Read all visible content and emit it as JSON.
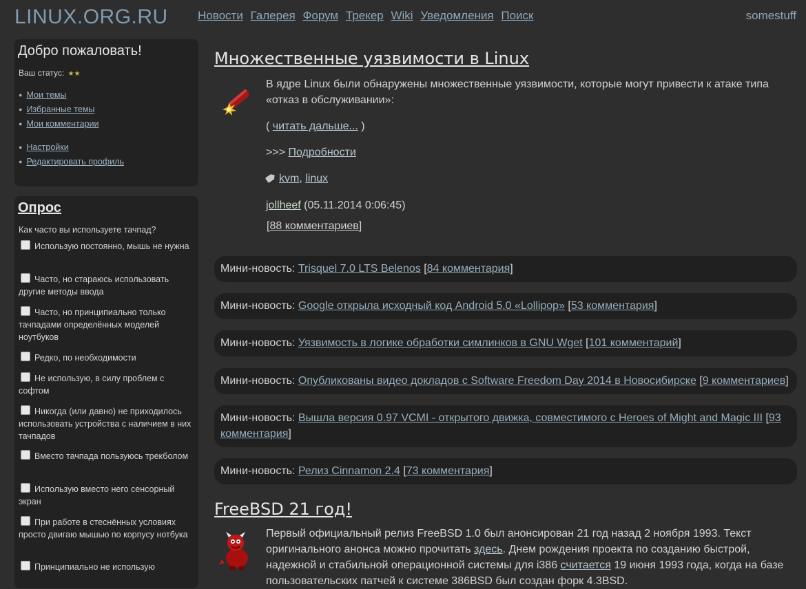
{
  "header": {
    "logo": "LINUX.ORG.RU",
    "nav": [
      "Новости",
      "Галерея",
      "Форум",
      "Трекер",
      "Wiki",
      "Уведомления",
      "Поиск"
    ],
    "user": "somestuff"
  },
  "welcome": {
    "title": "Добро пожаловать!",
    "status_label": "Ваш статус:",
    "stars": "★★",
    "links_group1": [
      "Мои темы",
      "Избранные темы",
      "Мои комментарии"
    ],
    "links_group2": [
      "Настройки",
      "Редактировать профиль"
    ]
  },
  "poll": {
    "title": "Опрос",
    "question": "Как часто вы используете тачпад?",
    "options": [
      "Использую постоянно, мышь не нужна",
      "Часто, но стараюсь использовать другие методы ввода",
      "Часто, но принципиально только тачпадами определённых моделей ноутбуков",
      "Редко, по необходимости",
      "Не использую, в силу проблем с софтом",
      "Никогда (или давно) не приходилось использовать устройства с наличием в них тачпадов",
      "Вместо тачпада пользуюсь трекболом",
      "Использую вместо него сенсорный экран",
      "При работе в стеснённых условиях просто двигаю мышью по корпусу нотбука",
      "Принципиально не использую"
    ]
  },
  "article1": {
    "title": "Множественные уязвимости в Linux",
    "text": "В ядре Linux были обнаружены множественные уязвимости, которые могут привести к атаке типа «отказ в обслуживании»:",
    "read_more_open": "( ",
    "read_more": "читать дальше...",
    "read_more_close": " )",
    "details_prefix": ">>> ",
    "details": "Подробности",
    "tag1": "kvm",
    "tag_sep": ", ",
    "tag2": "linux",
    "author": "jollheef",
    "date": " (05.11.2014 0:06:45)",
    "comments": "88 комментариев"
  },
  "mini_news": [
    {
      "label": "Мини-новость: ",
      "title": "Trisquel 7.0 LTS Belenos",
      "comments": "84 комментария"
    },
    {
      "label": "Мини-новость: ",
      "title": "Google открыла исходный код Android 5.0 «Lollipop»",
      "comments": "53 комментария"
    },
    {
      "label": "Мини-новость: ",
      "title": "Уязвимость в логике обработки симлинков в GNU Wget",
      "comments": "101 комментарий"
    },
    {
      "label": "Мини-новость: ",
      "title": "Опубликованы видео докладов с Software Freedom Day 2014 в Новосибирске",
      "comments": "9 комментариев"
    },
    {
      "label": "Мини-новость: ",
      "title": "Вышла версия 0.97 VCMI - открытого движка, совместимого с Heroes of Might and Magic III",
      "comments": "93 комментария"
    },
    {
      "label": "Мини-новость: ",
      "title": "Релиз Cinnamon 2.4",
      "comments": "73 комментария"
    }
  ],
  "article2": {
    "title": "FreeBSD 21 год!",
    "text1": "Первый официальный релиз FreeBSD 1.0 был анонсирован 21 год назад 2 ноября 1993. Текст оригинального анонса можно прочитать ",
    "link1": "здесь",
    "text2": ". Днем рождения проекта по созданию быстрой, надежной и стабильной операционной системы для i386 ",
    "link2": "считается",
    "text3": " 19 июня 1993 года, когда на базе пользовательских патчей к системе 386BSD был создан форк 4.3BSD."
  },
  "colors": {
    "background": "#2e2e2e",
    "box": "#222222",
    "link": "#b8c6cf",
    "logo": "#7f9bb0"
  }
}
